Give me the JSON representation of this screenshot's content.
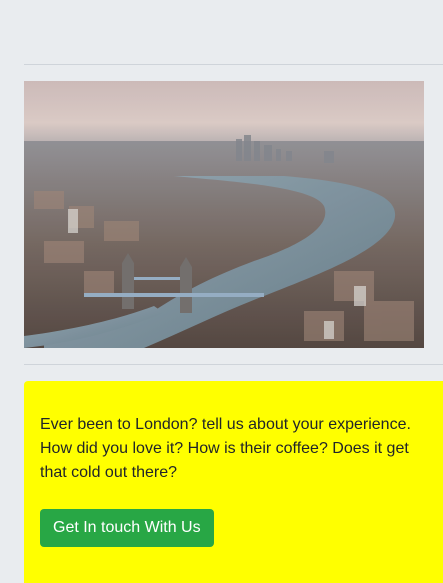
{
  "image": {
    "alt": "Aerial view of London",
    "subject": "london-skyline-photo"
  },
  "cta": {
    "text": "Ever been to London? tell us about your experience. How did you love it? How is their coffee? Does it get that cold out there?",
    "button_label": "Get In touch With Us"
  },
  "colors": {
    "page_background": "#e9ecef",
    "card_background": "#ffff00",
    "button_background": "#28a745",
    "button_text": "#ffffff",
    "body_text": "#212529"
  }
}
